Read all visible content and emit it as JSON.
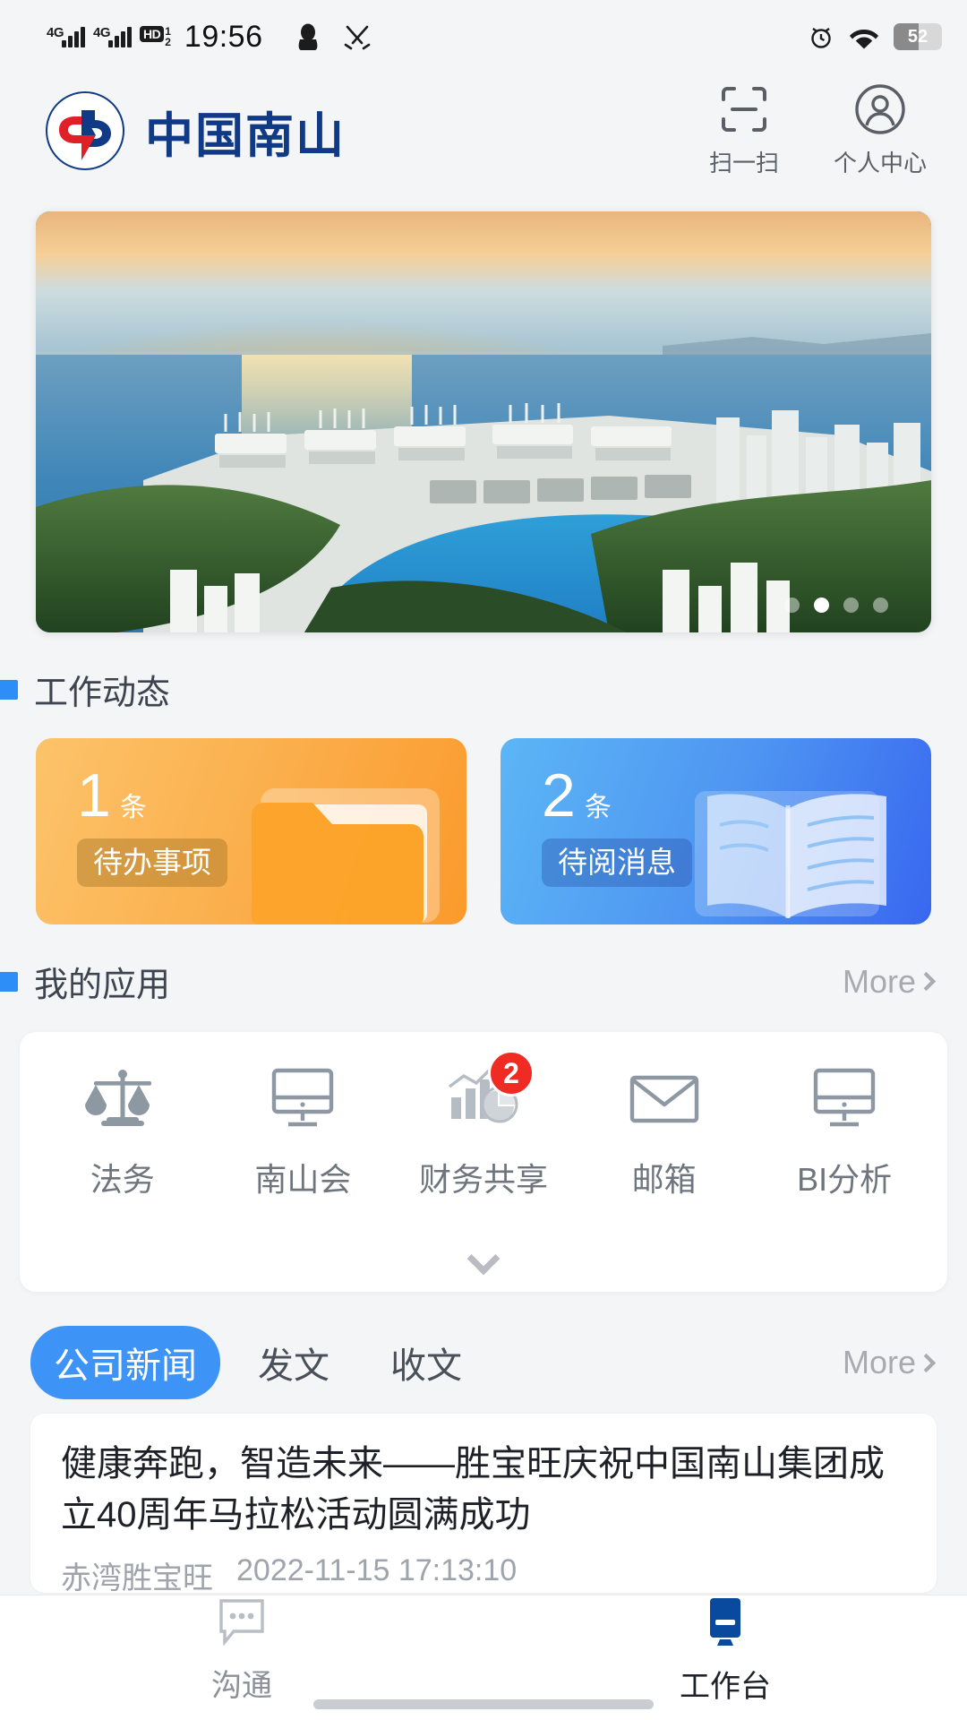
{
  "status_bar": {
    "network_1": "4G",
    "network_2": "4G",
    "hd_label": "HD",
    "hd_sub_top": "1",
    "hd_sub_bottom": "2",
    "time": "19:56",
    "icons": [
      "qq-penguin-icon",
      "tools-icon",
      "alarm-icon",
      "wifi-icon"
    ],
    "battery_percent": "52"
  },
  "header": {
    "logo_name": "logo-mark",
    "brand_title": "中国南山",
    "actions": [
      {
        "icon": "scan-icon",
        "label": "扫一扫"
      },
      {
        "icon": "person-icon",
        "label": "个人中心"
      }
    ]
  },
  "banner": {
    "alt": "中国南山港口鸟瞰图",
    "dot_count": 4,
    "active_dot": 1
  },
  "work_status": {
    "section_title": "工作动态",
    "cards": [
      {
        "count": "1",
        "unit": "条",
        "label": "待办事项",
        "art": "folder-illustration",
        "color": "#fbb04e"
      },
      {
        "count": "2",
        "unit": "条",
        "label": "待阅消息",
        "art": "book-illustration",
        "color": "#4e95f2"
      }
    ]
  },
  "my_apps": {
    "section_title": "我的应用",
    "more_label": "More",
    "items": [
      {
        "label": "法务",
        "icon": "scales-icon",
        "badge": ""
      },
      {
        "label": "南山会",
        "icon": "monitor-icon",
        "badge": ""
      },
      {
        "label": "财务共享",
        "icon": "chart-icon",
        "badge": "2"
      },
      {
        "label": "邮箱",
        "icon": "envelope-icon",
        "badge": ""
      },
      {
        "label": "BI分析",
        "icon": "monitor-icon",
        "badge": ""
      }
    ],
    "expand_icon": "chevron-down-icon"
  },
  "news": {
    "tabs": [
      {
        "label": "公司新闻",
        "active": true
      },
      {
        "label": "发文",
        "active": false
      },
      {
        "label": "收文",
        "active": false
      }
    ],
    "more_label": "More",
    "items": [
      {
        "title": "健康奔跑，智造未来——胜宝旺庆祝中国南山集团成立40周年马拉松活动圆满成功",
        "source": "赤湾胜宝旺",
        "time": "2022-11-15 17:13:10"
      }
    ]
  },
  "bottom_nav": {
    "items": [
      {
        "label": "沟通",
        "icon": "chat-bubble-icon",
        "active": false
      },
      {
        "label": "工作台",
        "icon": "workbench-monitor-icon",
        "active": true
      }
    ]
  },
  "colors": {
    "accent_blue": "#2e8ef7",
    "brand_blue": "#103a86",
    "badge_red": "#ef2b23",
    "card_orange": "#fbb04e",
    "page_bg": "#f4f5f7"
  }
}
